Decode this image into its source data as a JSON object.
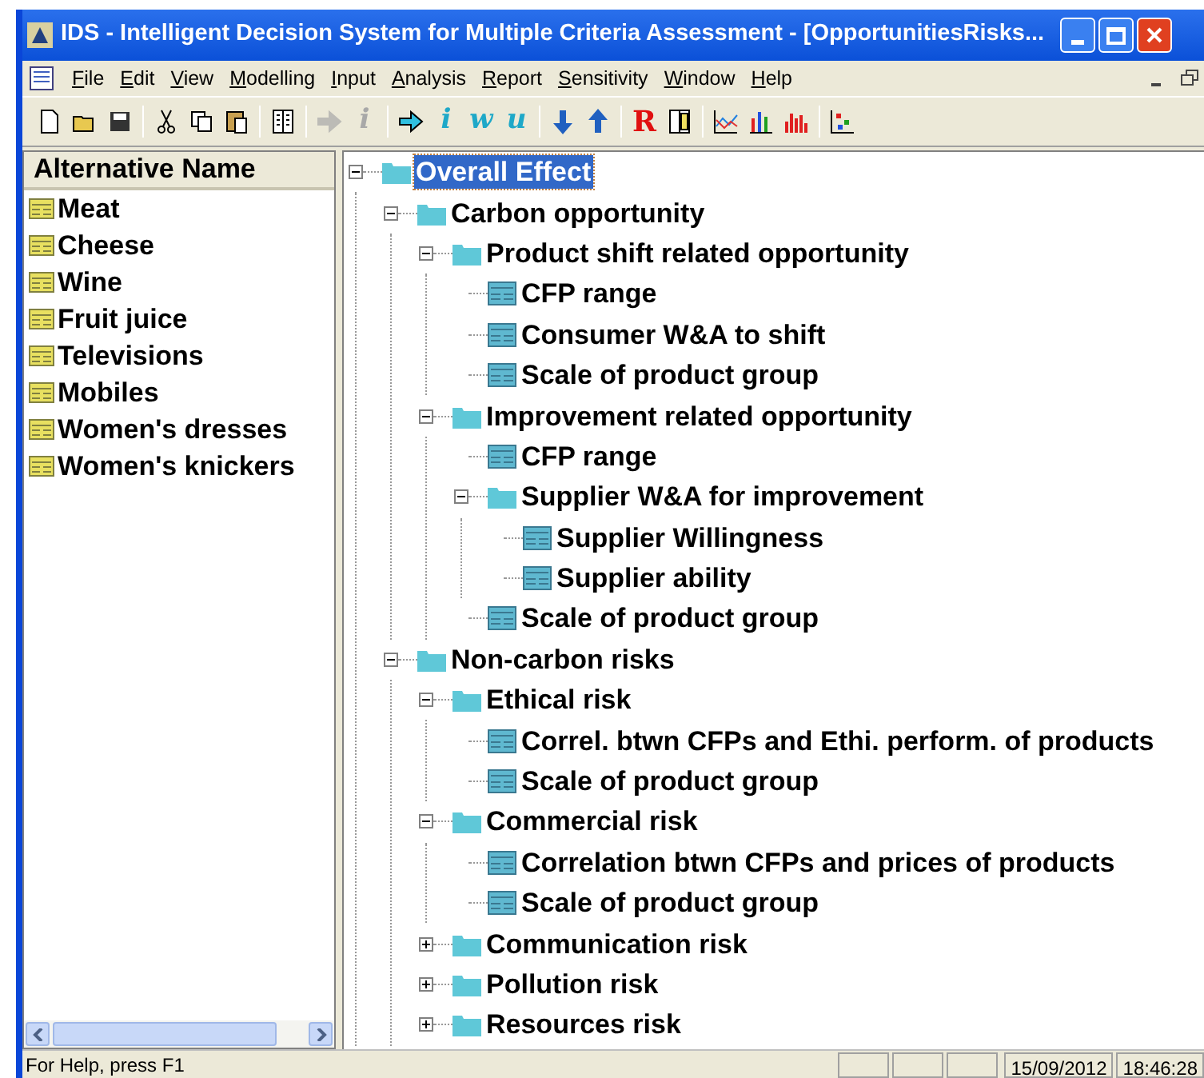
{
  "window": {
    "title": "IDS - Intelligent Decision System for Multiple Criteria Assessment - [OpportunitiesRisks..."
  },
  "menu": [
    "File",
    "Edit",
    "View",
    "Modelling",
    "Input",
    "Analysis",
    "Report",
    "Sensitivity",
    "Window",
    "Help"
  ],
  "toolbar": [
    {
      "kind": "new",
      "disabled": false
    },
    {
      "kind": "open",
      "disabled": false
    },
    {
      "kind": "save",
      "disabled": false
    },
    {
      "kind": "sep"
    },
    {
      "kind": "cut",
      "disabled": false
    },
    {
      "kind": "copy",
      "disabled": false
    },
    {
      "kind": "paste",
      "disabled": false
    },
    {
      "kind": "sep"
    },
    {
      "kind": "pane",
      "disabled": false
    },
    {
      "kind": "sep"
    },
    {
      "kind": "arrow",
      "disabled": true
    },
    {
      "kind": "glyph",
      "text": "i",
      "disabled": true
    },
    {
      "kind": "sep"
    },
    {
      "kind": "arrow",
      "disabled": false
    },
    {
      "kind": "glyph",
      "text": "i",
      "disabled": false
    },
    {
      "kind": "glyph",
      "text": "w",
      "disabled": false
    },
    {
      "kind": "glyph",
      "text": "u",
      "disabled": false
    },
    {
      "kind": "sep"
    },
    {
      "kind": "down",
      "disabled": false
    },
    {
      "kind": "up",
      "disabled": false
    },
    {
      "kind": "sep"
    },
    {
      "kind": "letter",
      "text": "R",
      "disabled": false
    },
    {
      "kind": "doc",
      "disabled": false
    },
    {
      "kind": "sep"
    },
    {
      "kind": "line",
      "disabled": false
    },
    {
      "kind": "bars",
      "disabled": false
    },
    {
      "kind": "redbars",
      "disabled": false
    },
    {
      "kind": "sep"
    },
    {
      "kind": "scatter",
      "disabled": false
    }
  ],
  "alternatives": {
    "header": "Alternative Name",
    "items": [
      "Meat",
      "Cheese",
      "Wine",
      "Fruit juice",
      "Televisions",
      "Mobiles",
      "Women's dresses",
      "Women's knickers"
    ]
  },
  "tree": {
    "label": "Overall Effect",
    "kind": "folder",
    "expanded": true,
    "selected": true,
    "children": [
      {
        "label": "Carbon opportunity",
        "kind": "folder",
        "expanded": true,
        "selected": false,
        "children": [
          {
            "label": "Product shift related opportunity",
            "kind": "folder",
            "expanded": true,
            "selected": false,
            "children": [
              {
                "label": "CFP range",
                "kind": "leaf",
                "selected": false
              },
              {
                "label": "Consumer W&A to shift",
                "kind": "leaf",
                "selected": false
              },
              {
                "label": "Scale of product group",
                "kind": "leaf",
                "selected": false
              }
            ]
          },
          {
            "label": "Improvement related opportunity",
            "kind": "folder",
            "expanded": true,
            "selected": false,
            "children": [
              {
                "label": "CFP range",
                "kind": "leaf",
                "selected": false
              },
              {
                "label": "Supplier W&A for improvement",
                "kind": "folder",
                "expanded": true,
                "selected": false,
                "children": [
                  {
                    "label": "Supplier Willingness",
                    "kind": "leaf",
                    "selected": false
                  },
                  {
                    "label": "Supplier ability",
                    "kind": "leaf",
                    "selected": false
                  }
                ]
              },
              {
                "label": "Scale of product group",
                "kind": "leaf",
                "selected": false
              }
            ]
          }
        ]
      },
      {
        "label": "Non-carbon risks",
        "kind": "folder",
        "expanded": true,
        "selected": false,
        "children": [
          {
            "label": "Ethical risk",
            "kind": "folder",
            "expanded": true,
            "selected": false,
            "children": [
              {
                "label": "Correl. btwn CFPs and Ethi. perform. of products",
                "kind": "leaf",
                "selected": false
              },
              {
                "label": "Scale of product group",
                "kind": "leaf",
                "selected": false
              }
            ]
          },
          {
            "label": "Commercial risk",
            "kind": "folder",
            "expanded": true,
            "selected": false,
            "children": [
              {
                "label": "Correlation btwn CFPs and prices of products",
                "kind": "leaf",
                "selected": false
              },
              {
                "label": "Scale of product group",
                "kind": "leaf",
                "selected": false
              }
            ]
          },
          {
            "label": "Communication risk",
            "kind": "folder",
            "expanded": false,
            "selected": false
          },
          {
            "label": "Pollution risk",
            "kind": "folder",
            "expanded": false,
            "selected": false
          },
          {
            "label": "Resources risk",
            "kind": "folder",
            "expanded": false,
            "selected": false
          }
        ]
      }
    ]
  },
  "status_bar": {
    "text": "For Help, press F1",
    "date": "15/09/2012",
    "time": "18:46:28"
  }
}
